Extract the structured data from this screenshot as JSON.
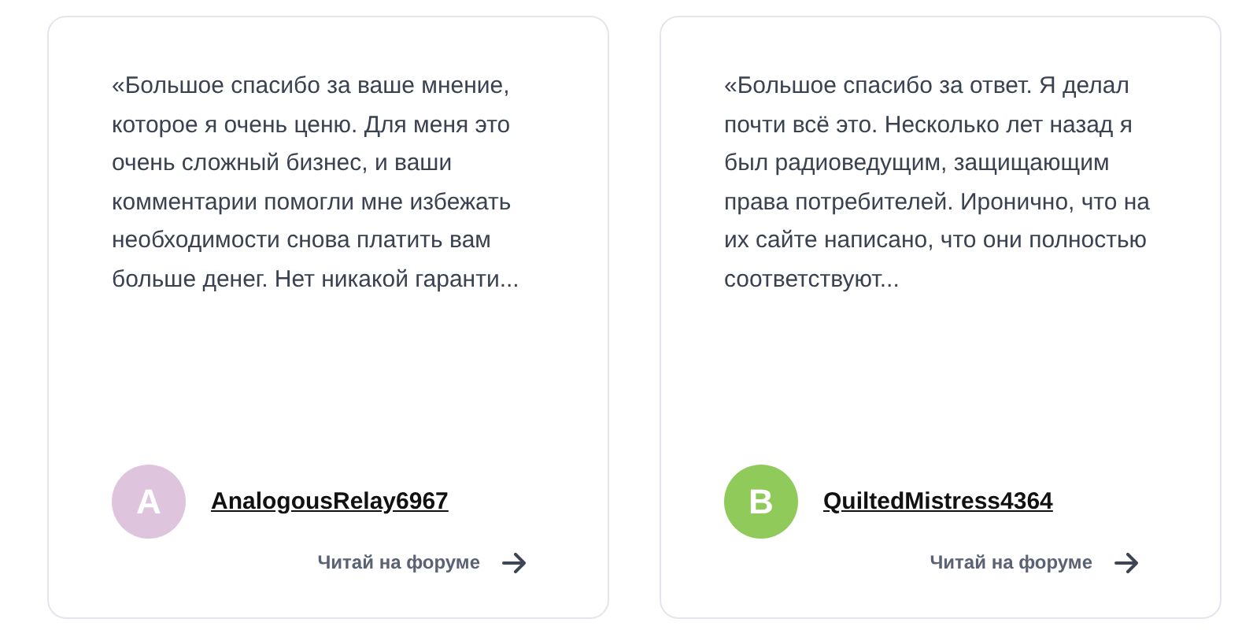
{
  "testimonials": [
    {
      "quote": "«Большое спасибо за ваше мнение, которое я очень ценю. Для меня это очень сложный бизнес, и ваши комментарии помогли мне избежать необходимости снова платить вам больше денег. Нет никакой гаранти...",
      "avatar": {
        "letter": "A",
        "color": "#dec4dd"
      },
      "author": "AnalogousRelay6967",
      "link": "Читай на форуме"
    },
    {
      "quote": "«Большое спасибо за ответ. Я делал почти всё это. Несколько лет назад я был радиоведущим, защищающим права потребителей. Иронично, что на их сайте написано, что они полностью соответствуют...",
      "avatar": {
        "letter": "B",
        "color": "#8fca5a"
      },
      "author": "QuiltedMistress4364",
      "link": "Читай на форуме"
    }
  ]
}
